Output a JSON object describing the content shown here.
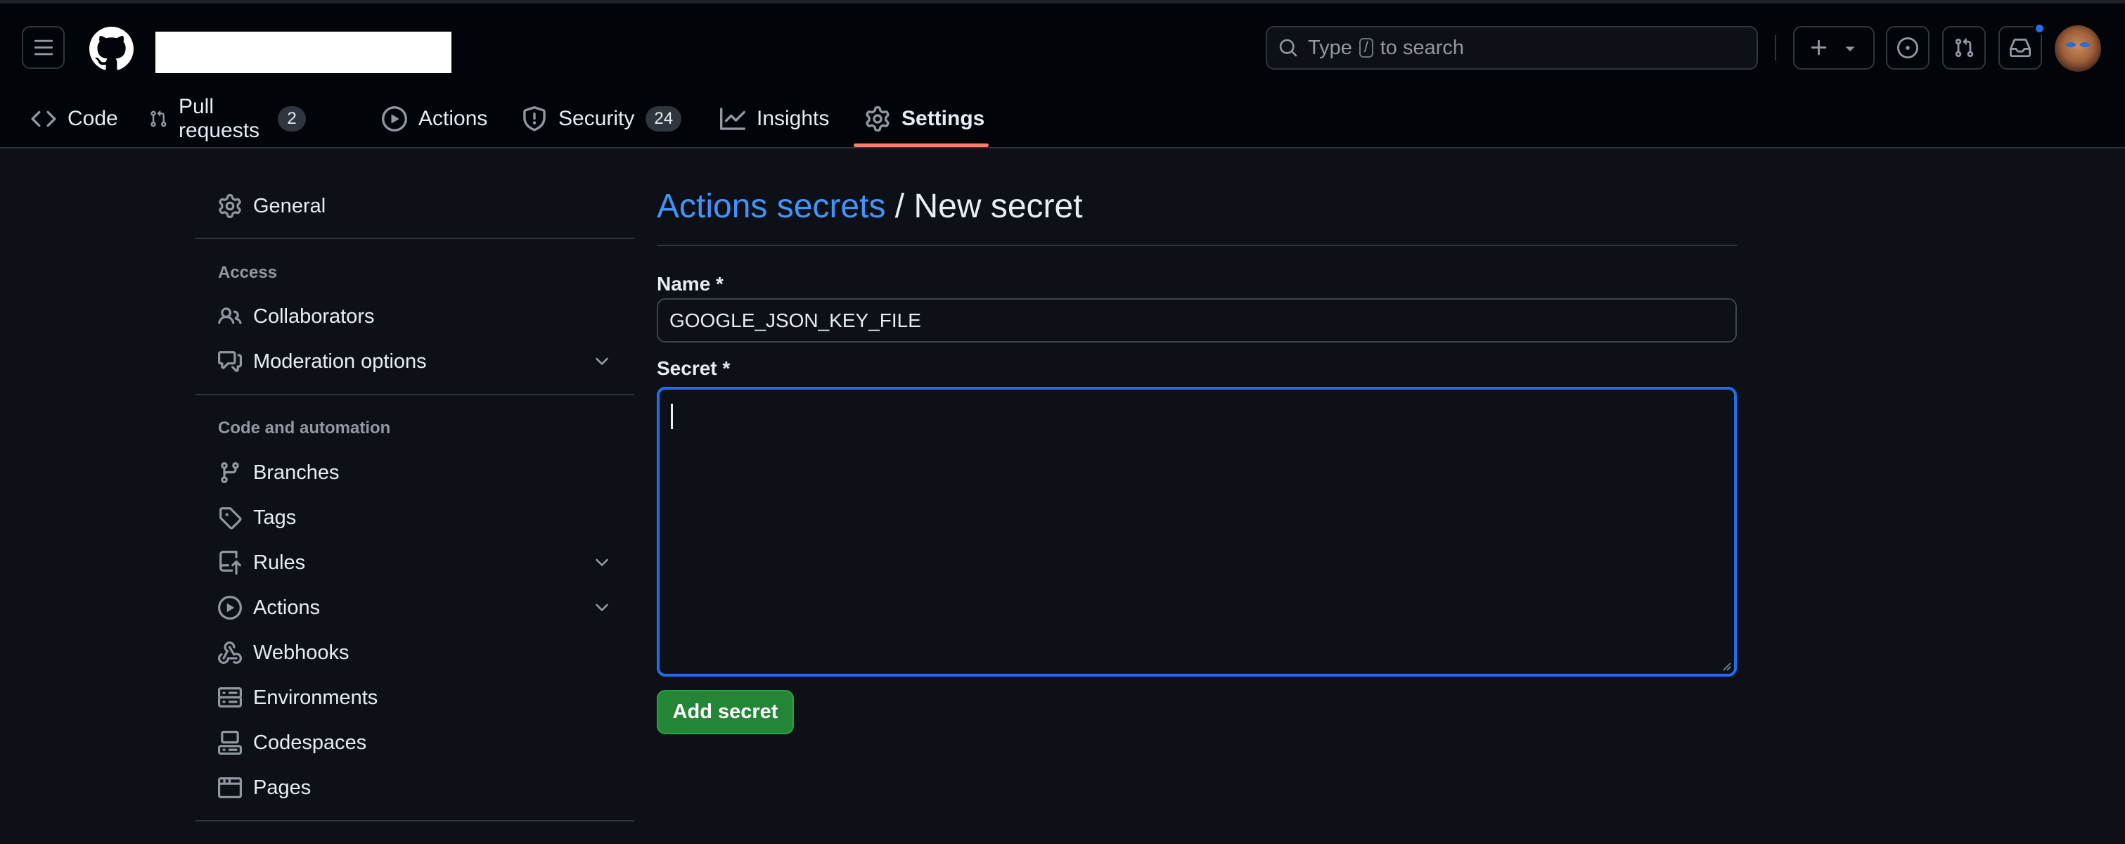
{
  "header": {
    "search_prefix": "Type",
    "search_key": "/",
    "search_suffix": "to search"
  },
  "tabs": [
    {
      "label": "Code",
      "icon": "code-icon"
    },
    {
      "label": "Pull requests",
      "icon": "git-pull-request-icon",
      "count": "2"
    },
    {
      "label": "Actions",
      "icon": "play-icon"
    },
    {
      "label": "Security",
      "icon": "shield-icon",
      "count": "24"
    },
    {
      "label": "Insights",
      "icon": "graph-icon"
    },
    {
      "label": "Settings",
      "icon": "gear-icon",
      "active": true
    }
  ],
  "sidebar": {
    "general": "General",
    "access_heading": "Access",
    "collaborators": "Collaborators",
    "moderation": "Moderation options",
    "code_heading": "Code and automation",
    "branches": "Branches",
    "tags": "Tags",
    "rules": "Rules",
    "actions": "Actions",
    "webhooks": "Webhooks",
    "environments": "Environments",
    "codespaces": "Codespaces",
    "pages": "Pages"
  },
  "main": {
    "breadcrumb_link": "Actions secrets",
    "breadcrumb_sep": "/",
    "title": "New secret",
    "name_label": "Name *",
    "name_value": "GOOGLE_JSON_KEY_FILE",
    "secret_label": "Secret *",
    "secret_value": "",
    "submit_label": "Add secret"
  },
  "colors": {
    "background": "#0d1117",
    "header": "#010409",
    "link": "#4493f8",
    "focus": "#1f6feb",
    "primary_button": "#238636",
    "active_tab": "#f78166"
  }
}
